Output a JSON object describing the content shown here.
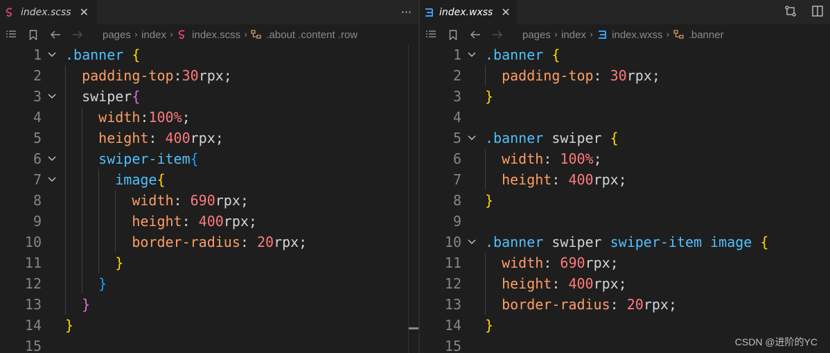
{
  "colors": {
    "selector": "#4fc1ff",
    "element": "#d4d4d4",
    "property": "#ff9e64",
    "number": "#ff7a7a",
    "unit": "#d4d4d4",
    "brace_gold": "#ffd700",
    "brace_pink": "#da70d6",
    "brace_blue": "#179fff",
    "scss_icon": "#e0457b",
    "css_icon": "#3b9df2"
  },
  "left": {
    "tab": {
      "name": "index.scss",
      "icon": "sass-file-icon",
      "close": "✕"
    },
    "more_icon": "···",
    "breadcrumb": {
      "items": [
        "pages",
        "index",
        "index.scss",
        ".about .content .row"
      ]
    },
    "gutter": [
      "1",
      "2",
      "3",
      "4",
      "5",
      "6",
      "7",
      "8",
      "9",
      "10",
      "11",
      "12",
      "13",
      "14",
      "15"
    ],
    "lines": [
      [
        [
          ".banner ",
          "#4fc1ff"
        ],
        [
          "{",
          "#ffd700"
        ]
      ],
      [
        [
          "  "
        ],
        [
          "padding-top",
          "#ff9e64"
        ],
        [
          ":",
          "#d4d4d4"
        ],
        [
          "30",
          "#ff7a7a"
        ],
        [
          "rpx;",
          "#d4d4d4"
        ]
      ],
      [
        [
          "  "
        ],
        [
          "swiper",
          "#d4d4d4"
        ],
        [
          "{",
          "#da70d6"
        ]
      ],
      [
        [
          "    "
        ],
        [
          "width",
          "#ff9e64"
        ],
        [
          ":",
          "#d4d4d4"
        ],
        [
          "100%",
          "#ff7a7a"
        ],
        [
          ";",
          "#d4d4d4"
        ]
      ],
      [
        [
          "    "
        ],
        [
          "height",
          "#ff9e64"
        ],
        [
          ": ",
          "#d4d4d4"
        ],
        [
          "400",
          "#ff7a7a"
        ],
        [
          "rpx;",
          "#d4d4d4"
        ]
      ],
      [
        [
          "    "
        ],
        [
          "swiper-item",
          "#4fc1ff"
        ],
        [
          "{",
          "#179fff"
        ]
      ],
      [
        [
          "      "
        ],
        [
          "image",
          "#4fc1ff"
        ],
        [
          "{",
          "#ffd700"
        ]
      ],
      [
        [
          "        "
        ],
        [
          "width",
          "#ff9e64"
        ],
        [
          ": ",
          "#d4d4d4"
        ],
        [
          "690",
          "#ff7a7a"
        ],
        [
          "rpx;",
          "#d4d4d4"
        ]
      ],
      [
        [
          "        "
        ],
        [
          "height",
          "#ff9e64"
        ],
        [
          ": ",
          "#d4d4d4"
        ],
        [
          "400",
          "#ff7a7a"
        ],
        [
          "rpx;",
          "#d4d4d4"
        ]
      ],
      [
        [
          "        "
        ],
        [
          "border-radius",
          "#ff9e64"
        ],
        [
          ": ",
          "#d4d4d4"
        ],
        [
          "20",
          "#ff7a7a"
        ],
        [
          "rpx;",
          "#d4d4d4"
        ]
      ],
      [
        [
          "      "
        ],
        [
          "}",
          "#ffd700"
        ]
      ],
      [
        [
          "    "
        ],
        [
          "}",
          "#179fff"
        ]
      ],
      [
        [
          "  "
        ],
        [
          "}",
          "#da70d6"
        ]
      ],
      [
        [
          "}",
          "#ffd700"
        ]
      ],
      []
    ]
  },
  "right": {
    "tab": {
      "name": "index.wxss",
      "icon": "css-file-icon",
      "close": "✕"
    },
    "breadcrumb": {
      "items": [
        "pages",
        "index",
        "index.wxss",
        ".banner"
      ]
    },
    "gutter": [
      "1",
      "2",
      "3",
      "4",
      "5",
      "6",
      "7",
      "8",
      "9",
      "10",
      "11",
      "12",
      "13",
      "14",
      "15"
    ],
    "lines": [
      [
        [
          ".banner ",
          "#4fc1ff"
        ],
        [
          "{",
          "#ffd700"
        ]
      ],
      [
        [
          "  "
        ],
        [
          "padding-top",
          "#ff9e64"
        ],
        [
          ": ",
          "#d4d4d4"
        ],
        [
          "30",
          "#ff7a7a"
        ],
        [
          "rpx;",
          "#d4d4d4"
        ]
      ],
      [
        [
          "}",
          "#ffd700"
        ]
      ],
      [],
      [
        [
          ".banner ",
          "#4fc1ff"
        ],
        [
          "swiper ",
          "#d4d4d4"
        ],
        [
          "{",
          "#ffd700"
        ]
      ],
      [
        [
          "  "
        ],
        [
          "width",
          "#ff9e64"
        ],
        [
          ": ",
          "#d4d4d4"
        ],
        [
          "100%",
          "#ff7a7a"
        ],
        [
          ";",
          "#d4d4d4"
        ]
      ],
      [
        [
          "  "
        ],
        [
          "height",
          "#ff9e64"
        ],
        [
          ": ",
          "#d4d4d4"
        ],
        [
          "400",
          "#ff7a7a"
        ],
        [
          "rpx;",
          "#d4d4d4"
        ]
      ],
      [
        [
          "}",
          "#ffd700"
        ]
      ],
      [],
      [
        [
          ".banner ",
          "#4fc1ff"
        ],
        [
          "swiper ",
          "#d4d4d4"
        ],
        [
          "swiper-item ",
          "#4fc1ff"
        ],
        [
          "image ",
          "#4fc1ff"
        ],
        [
          "{",
          "#ffd700"
        ]
      ],
      [
        [
          "  "
        ],
        [
          "width",
          "#ff9e64"
        ],
        [
          ": ",
          "#d4d4d4"
        ],
        [
          "690",
          "#ff7a7a"
        ],
        [
          "rpx;",
          "#d4d4d4"
        ]
      ],
      [
        [
          "  "
        ],
        [
          "height",
          "#ff9e64"
        ],
        [
          ": ",
          "#d4d4d4"
        ],
        [
          "400",
          "#ff7a7a"
        ],
        [
          "rpx;",
          "#d4d4d4"
        ]
      ],
      [
        [
          "  "
        ],
        [
          "border-radius",
          "#ff9e64"
        ],
        [
          ": ",
          "#d4d4d4"
        ],
        [
          "20",
          "#ff7a7a"
        ],
        [
          "rpx;",
          "#d4d4d4"
        ]
      ],
      [
        [
          "}",
          "#ffd700"
        ]
      ],
      []
    ]
  },
  "watermark": "CSDN @进阶的YC"
}
